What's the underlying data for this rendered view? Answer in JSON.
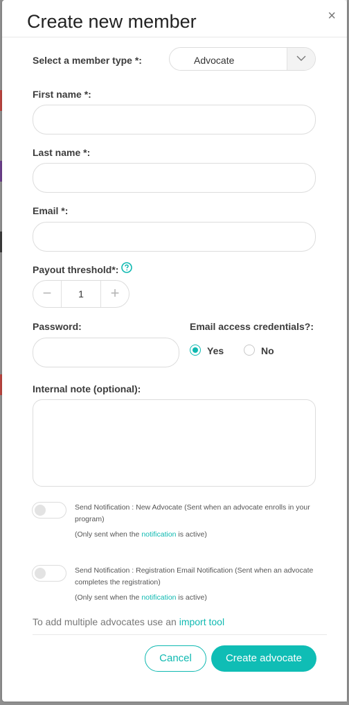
{
  "modal": {
    "title": "Create new member",
    "close_symbol": "×"
  },
  "member_type": {
    "label": "Select a member type *:",
    "selected": "Advocate"
  },
  "first_name": {
    "label": "First name *:",
    "value": ""
  },
  "last_name": {
    "label": "Last name *:",
    "value": ""
  },
  "email": {
    "label": "Email *:",
    "value": ""
  },
  "payout_threshold": {
    "label": "Payout threshold*:",
    "value": "1",
    "minus": "−",
    "plus": "+"
  },
  "password": {
    "label": "Password:",
    "value": ""
  },
  "email_credentials": {
    "label": "Email access credentials?:",
    "options": [
      "Yes",
      "No"
    ],
    "selected": "Yes"
  },
  "internal_note": {
    "label": "Internal note (optional):",
    "value": ""
  },
  "notifications": [
    {
      "text": "Send Notification : New Advocate (Sent when an advocate enrolls in your program)",
      "note_prefix": "(Only sent when the ",
      "note_link": "notification",
      "note_suffix": " is active)",
      "enabled": false
    },
    {
      "text": "Send Notification : Registration Email Notification (Sent when an advocate completes the registration)",
      "note_prefix": "(Only sent when the ",
      "note_link": "notification",
      "note_suffix": " is active)",
      "enabled": false
    }
  ],
  "import": {
    "text": "To add multiple advocates use an ",
    "link": "import tool"
  },
  "buttons": {
    "cancel": "Cancel",
    "create": "Create advocate"
  },
  "colors": {
    "accent": "#0fb9b1",
    "backdrop": "#8f8f8f"
  }
}
